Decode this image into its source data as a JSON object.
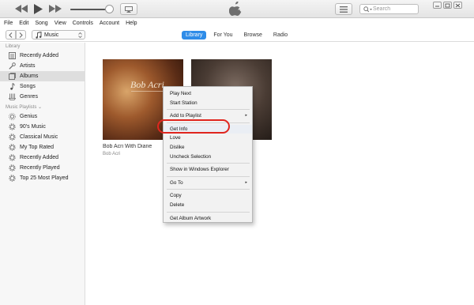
{
  "toolbar": {
    "rewind_icon": "rewind-icon",
    "play_icon": "play-icon",
    "forward_icon": "fast-forward-icon",
    "volume_level": 0.8,
    "airplay_icon": "airplay-icon",
    "apple_logo": "apple-logo-icon",
    "list_icon": "list-icon",
    "search_placeholder": "Search",
    "window_controls": [
      "minimize-icon",
      "restore-icon",
      "close-icon"
    ]
  },
  "menubar": {
    "items": [
      "File",
      "Edit",
      "Song",
      "View",
      "Controls",
      "Account",
      "Help"
    ]
  },
  "nav": {
    "media_type": "Music",
    "tabs": [
      "Library",
      "For You",
      "Browse",
      "Radio"
    ],
    "active_tab": "Library"
  },
  "sidebar": {
    "library_title": "Library",
    "library_items": [
      {
        "label": "Recently Added",
        "icon": "recently-added-icon"
      },
      {
        "label": "Artists",
        "icon": "artists-icon"
      },
      {
        "label": "Albums",
        "icon": "albums-icon",
        "selected": true
      },
      {
        "label": "Songs",
        "icon": "note-icon"
      },
      {
        "label": "Genres",
        "icon": "genres-icon"
      }
    ],
    "playlists_title": "Music Playlists ⌄",
    "playlist_items": [
      {
        "label": "Genius",
        "icon": "genius-icon"
      },
      {
        "label": "90's Music",
        "icon": "gear-icon"
      },
      {
        "label": "Classical Music",
        "icon": "gear-icon"
      },
      {
        "label": "My Top Rated",
        "icon": "gear-icon"
      },
      {
        "label": "Recently Added",
        "icon": "gear-icon"
      },
      {
        "label": "Recently Played",
        "icon": "gear-icon"
      },
      {
        "label": "Top 25 Most Played",
        "icon": "gear-icon"
      }
    ]
  },
  "albums": [
    {
      "title": "Bob Acri With Diane",
      "artist": "Bob Acri",
      "cover_text": "Bob Acri"
    },
    {
      "title": "",
      "artist": "",
      "cover_text": ""
    }
  ],
  "context_menu": {
    "items": [
      {
        "label": "Play Next"
      },
      {
        "label": "Start Station"
      },
      {
        "separator": true
      },
      {
        "label": "Add to Playlist",
        "submenu": true
      },
      {
        "separator": true
      },
      {
        "label": "Get Info",
        "highlighted": true
      },
      {
        "label": "Love"
      },
      {
        "label": "Dislike"
      },
      {
        "label": "Uncheck Selection"
      },
      {
        "separator": true
      },
      {
        "label": "Show in Windows Explorer"
      },
      {
        "separator": true
      },
      {
        "label": "Go To",
        "submenu": true
      },
      {
        "separator": true
      },
      {
        "label": "Copy"
      },
      {
        "label": "Delete"
      },
      {
        "separator": true
      },
      {
        "label": "Get Album Artwork"
      }
    ],
    "submenu_arrow": "▸"
  },
  "colors": {
    "accent": "#2e8ce8",
    "annotation_ring": "#e0261e"
  }
}
